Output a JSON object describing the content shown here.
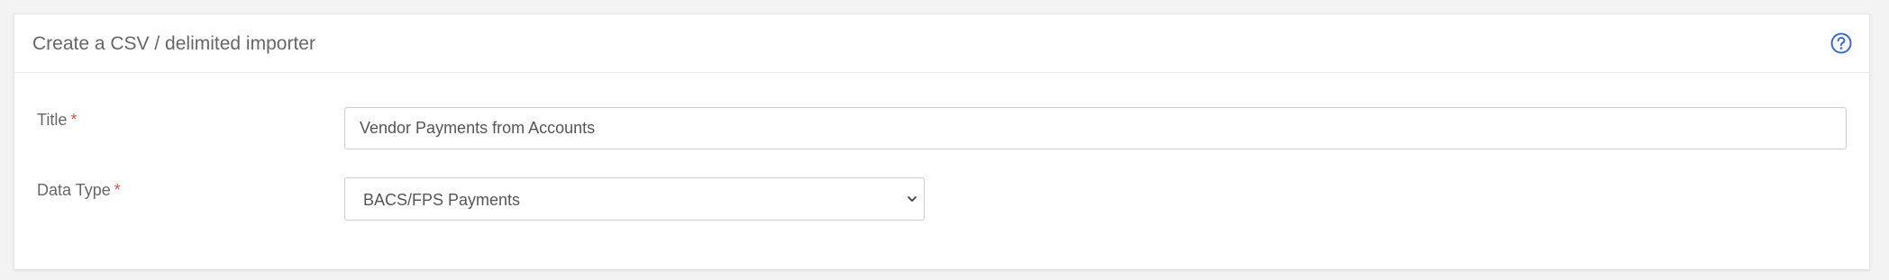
{
  "panel": {
    "title": "Create a CSV / delimited importer",
    "help_icon": "question-circle-icon",
    "accent_color": "#3b6bc7"
  },
  "form": {
    "title_field": {
      "label": "Title",
      "required_marker": "*",
      "value": "Vendor Payments from Accounts"
    },
    "data_type_field": {
      "label": "Data Type",
      "required_marker": "*",
      "selected": "BACS/FPS Payments"
    }
  },
  "colors": {
    "required": "#d9534f",
    "label": "#666666",
    "border": "#cccccc"
  }
}
